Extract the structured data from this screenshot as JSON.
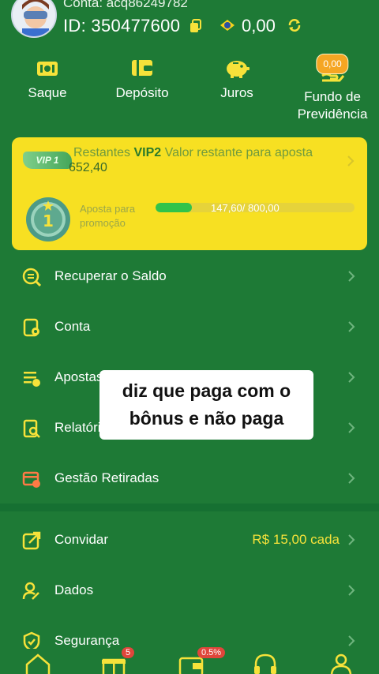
{
  "header": {
    "account_label": "Conta: acq86249782",
    "user_id": "ID: 350477600",
    "balance": "0,00"
  },
  "quick_actions": [
    {
      "label": "Saque",
      "icon": "withdraw-ticket-icon"
    },
    {
      "label": "Depósito",
      "icon": "wallet-icon"
    },
    {
      "label": "Juros",
      "icon": "piggy-bank-icon"
    },
    {
      "label": "Fundo de\nPrevidência",
      "icon": "hand-coins-icon",
      "badge": "0,00"
    }
  ],
  "vip": {
    "badge": "VIP 1",
    "remaining_label": "Restantes",
    "next_level": "VIP2",
    "remaining_text": "Valor restante para aposta",
    "remaining_value": "652,40",
    "level_number": "1",
    "promo_label": "Aposta para promoção",
    "progress_text": "147,60/ 800,00",
    "progress_fraction": 0.1845
  },
  "menu": [
    {
      "label": "Recuperar o Saldo",
      "icon": "recover-balance-icon"
    },
    {
      "label": "Conta",
      "icon": "account-icon"
    },
    {
      "label": "Apostas",
      "icon": "bets-icon"
    },
    {
      "label": "Relatório",
      "icon": "report-icon"
    },
    {
      "label": "Gestão Retiradas",
      "icon": "withdraw-management-icon"
    }
  ],
  "menu2": [
    {
      "label": "Convidar",
      "icon": "invite-icon",
      "value": "R$ 15,00 cada"
    },
    {
      "label": "Dados",
      "icon": "user-data-icon"
    },
    {
      "label": "Segurança",
      "icon": "security-icon"
    }
  ],
  "caption": "diz que paga com o bônus e não paga",
  "bottom_nav": {
    "gift_badge": "5",
    "wallet_badge": "0.5%"
  },
  "colors": {
    "background": "#1e7a36",
    "vip_card": "#f7e022",
    "accent_yellow": "#f6e23a",
    "progress": "#31c34a"
  }
}
